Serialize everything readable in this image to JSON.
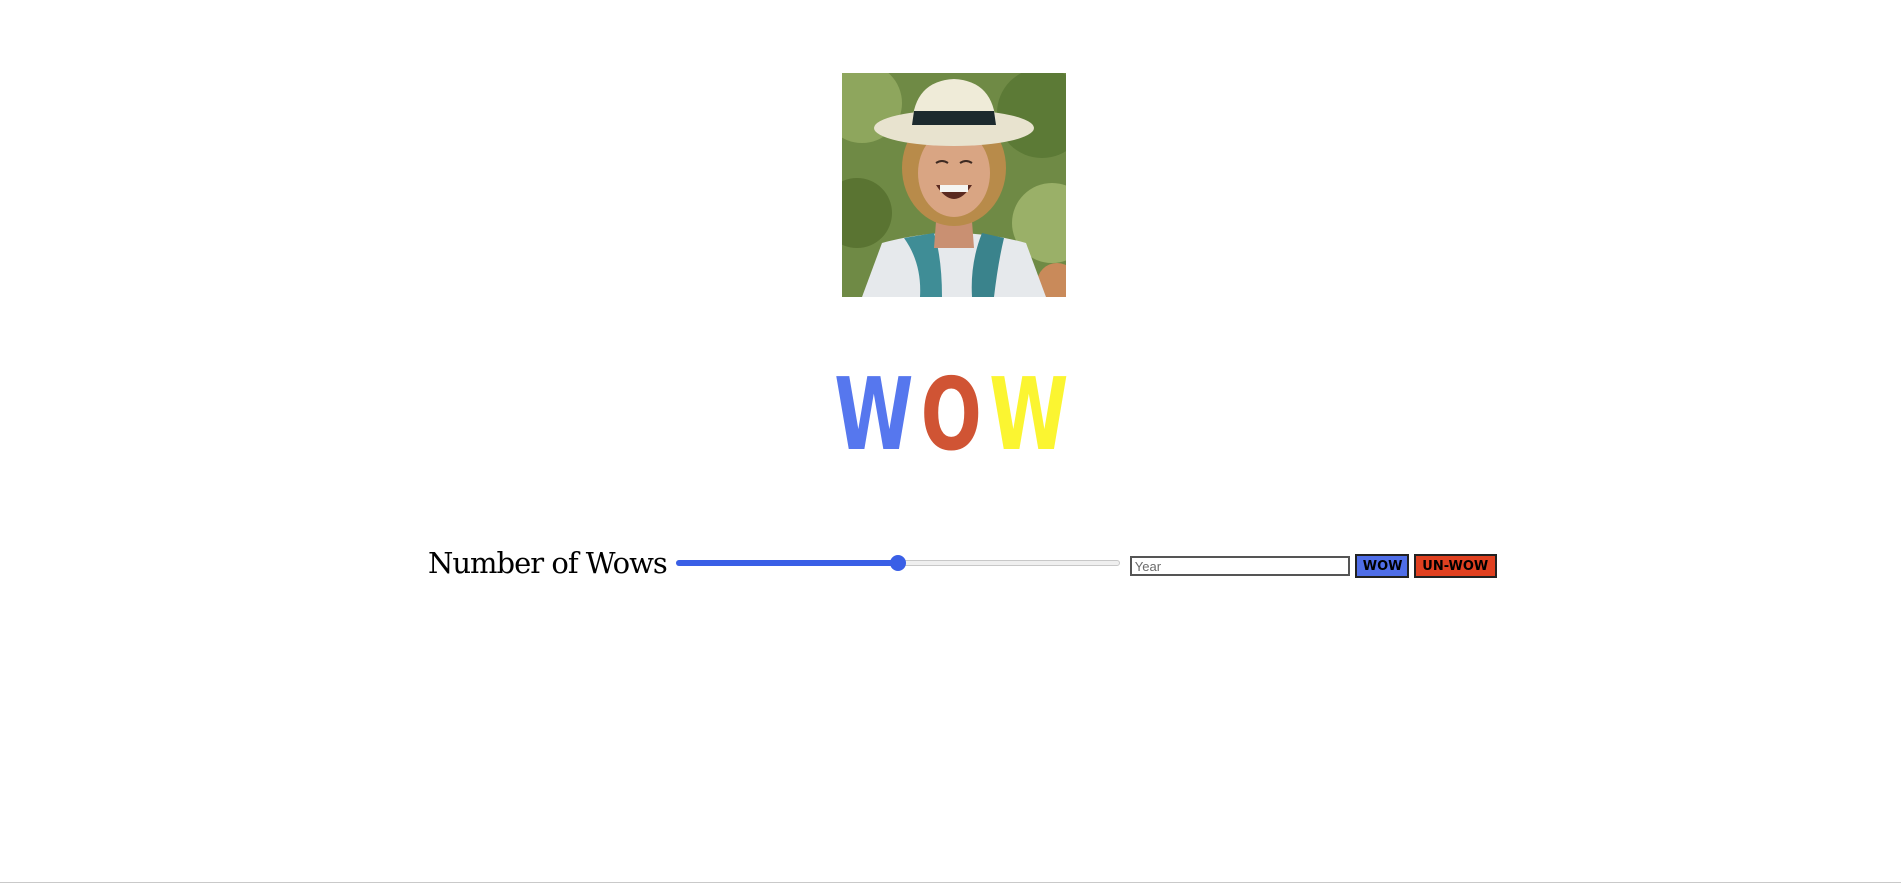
{
  "colors": {
    "wow_w1": "#5677ee",
    "wow_o": "#d05434",
    "wow_w2": "#fbf531",
    "slider_accent": "#3a5fe6",
    "wow_button_bg": "#4f6ee8",
    "unwow_button_bg": "#e04020"
  },
  "portrait": {
    "image_name": "portrait-photo"
  },
  "title": {
    "letter1": "W",
    "letter2": "O",
    "letter3": "W"
  },
  "controls": {
    "label": "Number of Wows",
    "slider_value_fraction": 0.5,
    "year_placeholder": "Year",
    "year_value": "",
    "wow_button_label": "WOW",
    "unwow_button_label": "UN-WOW"
  }
}
